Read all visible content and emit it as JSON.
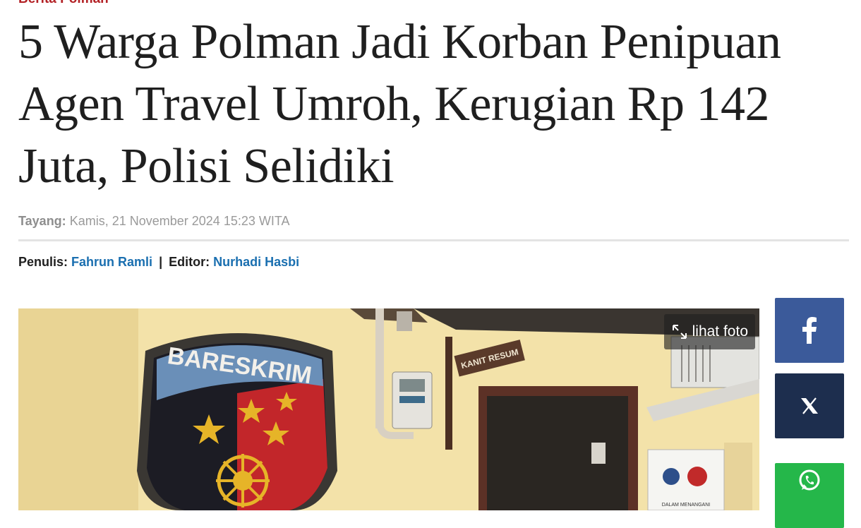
{
  "article": {
    "category": "Berita Polman",
    "headline": "5 Warga Polman Jadi Korban Penipuan Agen Travel Umroh, Kerugian Rp 142 Juta, Polisi Selidiki",
    "published_label": "Tayang:",
    "published_value": "Kamis, 21 November 2024 15:23 WITA",
    "author_label": "Penulis:",
    "author_name": "Fahrun Ramli",
    "separator": "|",
    "editor_label": "Editor:",
    "editor_name": "Nurhadi Hasbi"
  },
  "photo": {
    "view_label": "lihat foto",
    "sign_text": "KANIT RESUM",
    "emblem_text": "BARESKRIM",
    "poster_text": "DALAM MENANGANI"
  },
  "share": {
    "facebook_icon": "facebook-icon",
    "x_icon": "x-icon",
    "whatsapp_icon": "whatsapp-icon"
  },
  "colors": {
    "category": "#b32226",
    "link": "#1a6fb0",
    "facebook": "#3b5a9a",
    "x": "#1d2e4e",
    "whatsapp": "#25b74a"
  }
}
